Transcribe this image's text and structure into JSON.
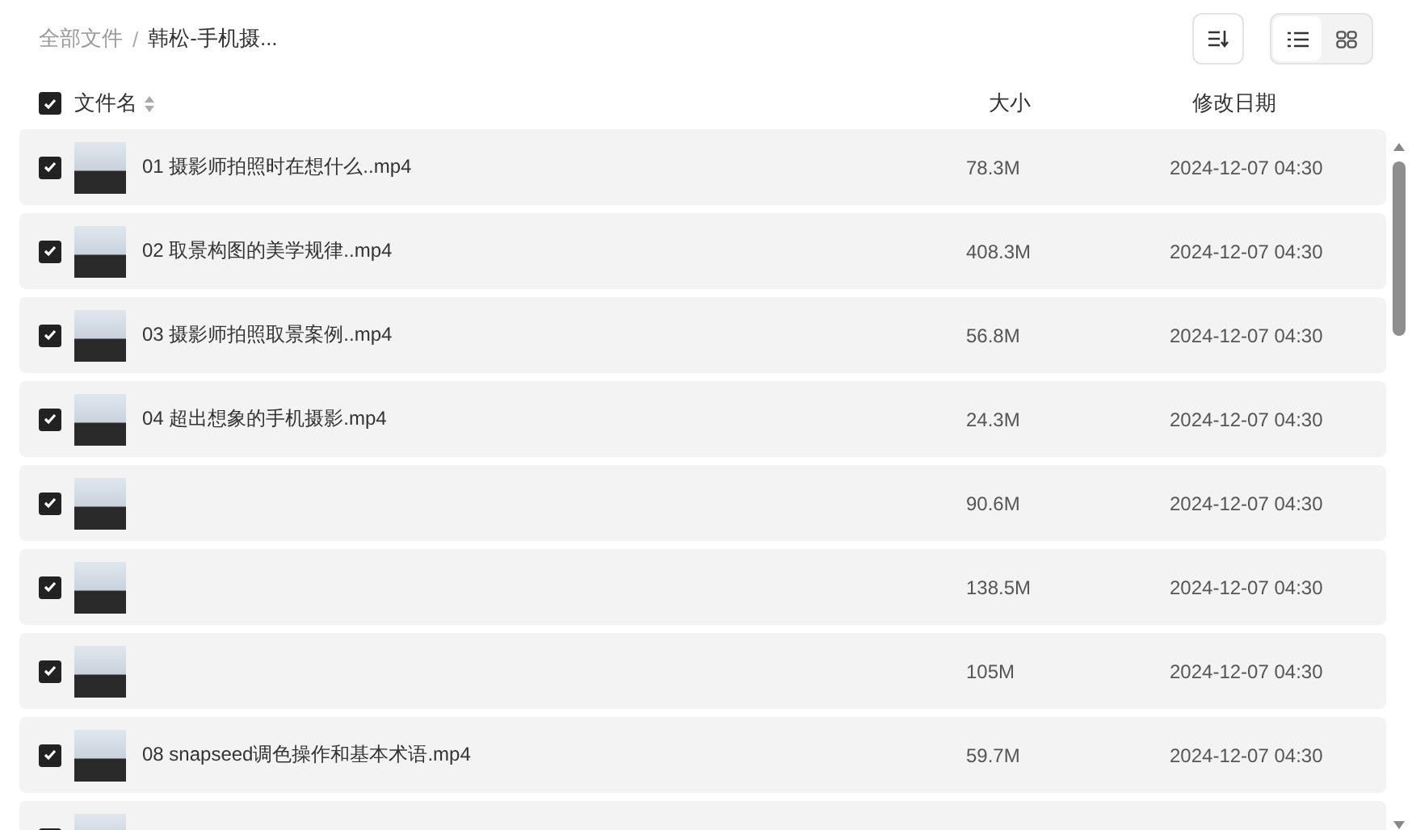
{
  "breadcrumb": {
    "separator": "/",
    "items": [
      {
        "label": "全部文件",
        "current": false
      },
      {
        "label": "韩松-手机摄...",
        "current": true
      }
    ]
  },
  "toolbar": {
    "view_modes": [
      {
        "kind": "list",
        "selected": true
      },
      {
        "kind": "grid",
        "selected": false
      }
    ]
  },
  "table": {
    "select_all": {
      "checked": true
    },
    "columns": [
      "文件名",
      "大小",
      "修改日期"
    ],
    "rows": [
      {
        "name": "01 摄影师拍照时在想什么..mp4",
        "size": "78.3M",
        "date": "2024-12-07 04:30",
        "selected": true
      },
      {
        "name": "02 取景构图的美学规律..mp4",
        "size": "408.3M",
        "date": "2024-12-07 04:30",
        "selected": true
      },
      {
        "name": "03 摄影师拍照取景案例..mp4",
        "size": "56.8M",
        "date": "2024-12-07 04:30",
        "selected": true
      },
      {
        "name": "04 超出想象的手机摄影.mp4",
        "size": "24.3M",
        "date": "2024-12-07 04:30",
        "selected": true
      },
      {
        "size": "90.6M",
        "date": "2024-12-07 04:30",
        "selected": true
      },
      {
        "size": "138.5M",
        "date": "2024-12-07 04:30",
        "selected": true
      },
      {
        "size": "105M",
        "date": "2024-12-07 04:30",
        "selected": true
      },
      {
        "name": "08 snapseed调色操作和基本术语.mp4",
        "size": "59.7M",
        "date": "2024-12-07 04:30",
        "selected": true
      },
      {
        "selected": true
      }
    ]
  }
}
